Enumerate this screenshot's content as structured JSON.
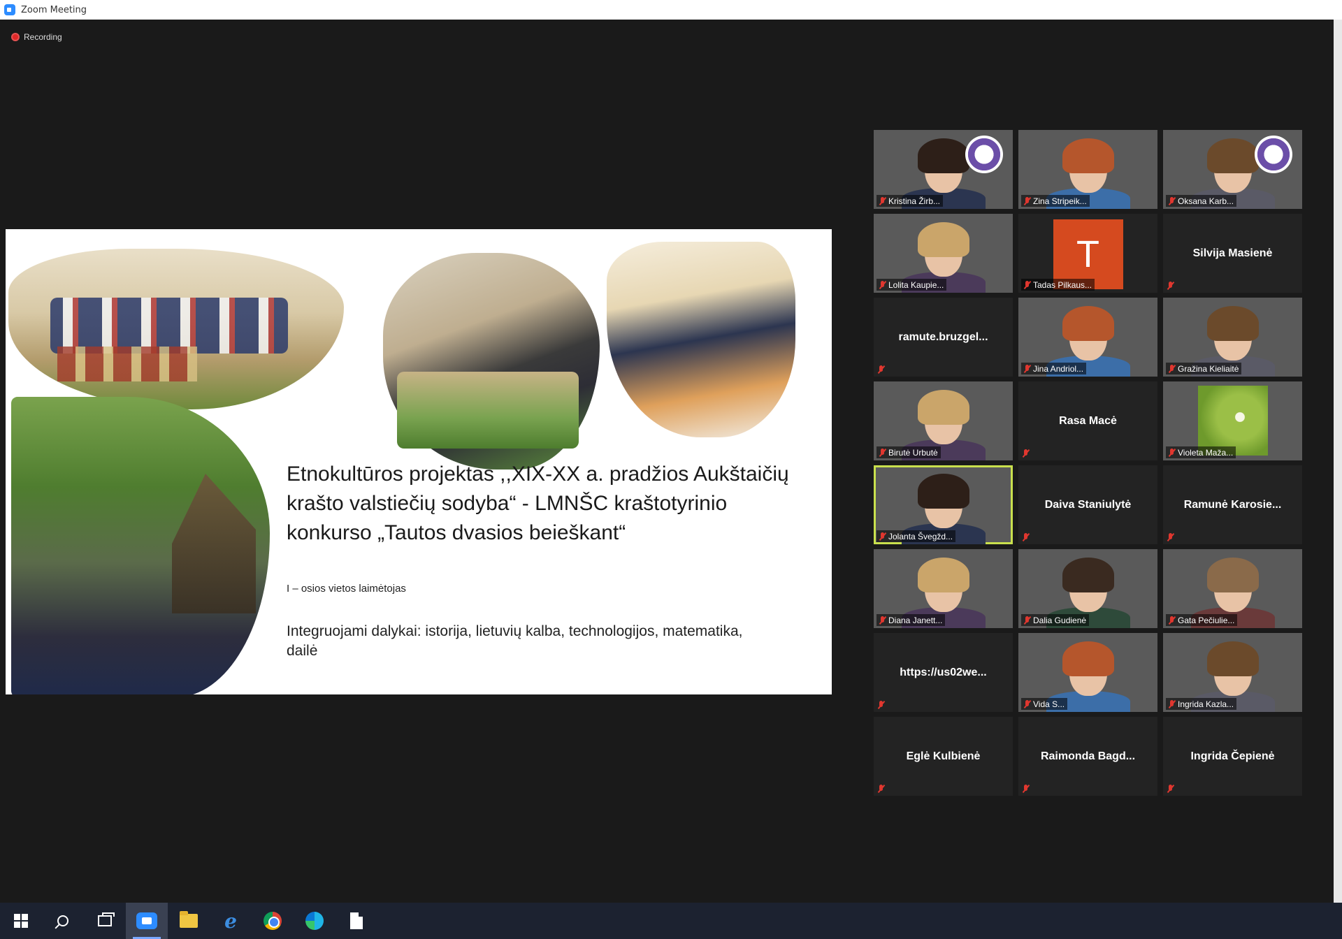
{
  "window": {
    "title": "Zoom Meeting"
  },
  "meeting": {
    "recording_label": "Recording",
    "slide": {
      "title": "Etnokultūros projektas ,,XIX-XX a. pradžios Aukštaičių krašto valstiečių sodyba“ - LMNŠC kraštotyrinio konkurso „Tautos dvasios beieškant“",
      "subtitle": "I – osios vietos laimėtojas",
      "integrated": "Integruojami dalykai: istorija, lietuvių kalba, technologijos, matematika, dailė"
    }
  },
  "participants": [
    {
      "name": "Kristina Žirb...",
      "kind": "video",
      "bg": "emblem"
    },
    {
      "name": "Zina Stripeik...",
      "kind": "video",
      "bg": "office"
    },
    {
      "name": "Oksana Karb...",
      "kind": "video",
      "bg": "emblem"
    },
    {
      "name": "Lolita Kaupie...",
      "kind": "video",
      "bg": "logos"
    },
    {
      "name": "Tadas Pilkaus...",
      "kind": "avatar",
      "initial": "T"
    },
    {
      "name": "Silvija Masienė",
      "kind": "name"
    },
    {
      "name": "ramute.bruzgel...",
      "kind": "name"
    },
    {
      "name": "Jina Andriol...",
      "kind": "video",
      "bg": "arrows"
    },
    {
      "name": "Gražina Kieliaitė",
      "kind": "video",
      "bg": "room"
    },
    {
      "name": "Birutė Urbutė",
      "kind": "video",
      "bg": "logos"
    },
    {
      "name": "Rasa Macė",
      "kind": "name"
    },
    {
      "name": "Violeta Maža...",
      "kind": "video",
      "bg": "green"
    },
    {
      "name": "Jolanta Švegžd...",
      "kind": "video",
      "bg": "grey",
      "active": true
    },
    {
      "name": "Daiva Staniulytė",
      "kind": "name"
    },
    {
      "name": "Ramunė Karosie...",
      "kind": "name"
    },
    {
      "name": "Diana Janett...",
      "kind": "video",
      "bg": "cream"
    },
    {
      "name": "Dalia Gudienė",
      "kind": "video",
      "bg": "tiles"
    },
    {
      "name": "Gata Pečiulie...",
      "kind": "video",
      "bg": "warm"
    },
    {
      "name": "https://us02we...",
      "kind": "name"
    },
    {
      "name": "Vida S...",
      "kind": "video",
      "bg": "arrows"
    },
    {
      "name": "Ingrida Kazla...",
      "kind": "video",
      "bg": "grey"
    },
    {
      "name": "Eglė Kulbienė",
      "kind": "name"
    },
    {
      "name": "Raimonda Bagd...",
      "kind": "name"
    },
    {
      "name": "Ingrida Čepienė",
      "kind": "name"
    }
  ],
  "taskbar": [
    {
      "icon": "windows-start-icon"
    },
    {
      "icon": "search-icon"
    },
    {
      "icon": "task-view-icon"
    },
    {
      "icon": "zoom-app-icon",
      "active": true
    },
    {
      "icon": "file-explorer-icon"
    },
    {
      "icon": "internet-explorer-icon"
    },
    {
      "icon": "chrome-icon"
    },
    {
      "icon": "edge-icon"
    },
    {
      "icon": "document-icon"
    }
  ]
}
